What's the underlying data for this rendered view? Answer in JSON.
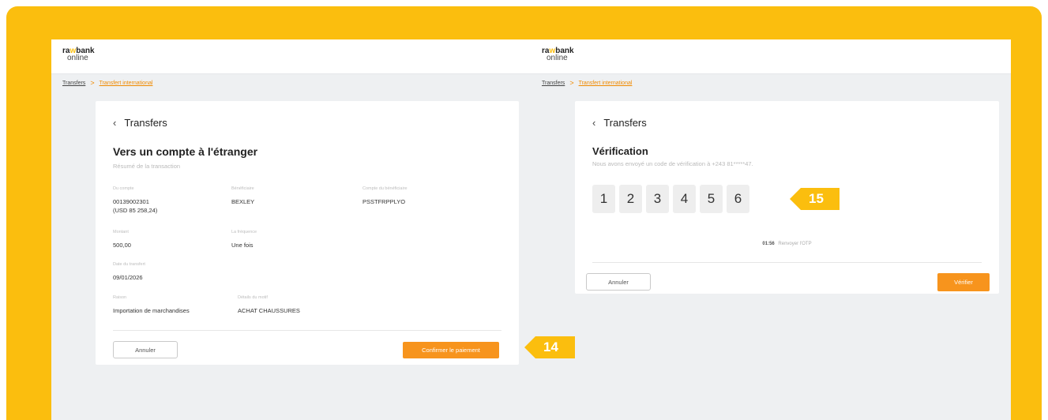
{
  "left": {
    "logo": {
      "line1a": "ra",
      "line1b": "w",
      "line1c": "bank",
      "line2": "online"
    },
    "breadcrumb": {
      "root": "Transfers",
      "sep": ">",
      "current": "Transfert international"
    },
    "back": "Transfers",
    "title": "Vers un compte à l'étranger",
    "subtitle": "Résumé de la transaction",
    "fields": {
      "from_label": "Du compte",
      "from_value1": "00139002301",
      "from_value2": "(USD 85 258,24)",
      "beneficiary_label": "Bénéficiaire",
      "beneficiary_value": "BEXLEY",
      "ben_account_label": "Compte du bénéficiaire",
      "ben_account_value": "PSSTFRPPLYO",
      "amount_label": "Montant",
      "amount_value": "500,00",
      "frequency_label": "La fréquence",
      "frequency_value": "Une fois",
      "date_label": "Date du transfert",
      "date_value": "09/01/2026",
      "reason_label": "Raison",
      "reason_value": "Importation de marchandises",
      "details_label": "Détails du motif",
      "details_value": "ACHAT CHAUSSURES"
    },
    "cancel": "Annuler",
    "confirm": "Confirmer le paiement"
  },
  "right": {
    "logo": {
      "line1a": "ra",
      "line1b": "w",
      "line1c": "bank",
      "line2": "online"
    },
    "breadcrumb": {
      "root": "Transfers",
      "sep": ">",
      "current": "Transfert international"
    },
    "back": "Transfers",
    "title": "Vérification",
    "subtitle": "Nous avons envoyé un code de vérification à +243 81*****47.",
    "otp": [
      "1",
      "2",
      "3",
      "4",
      "5",
      "6"
    ],
    "timer": "01:56",
    "resend": "Renvoyer l'OTP",
    "cancel": "Annuler",
    "verify": "Vérifier"
  },
  "badges": {
    "step14": "14",
    "step15": "15"
  },
  "colors": {
    "frame": "#fbbe0e",
    "accent": "#f7941d",
    "background": "#eef0f2"
  }
}
